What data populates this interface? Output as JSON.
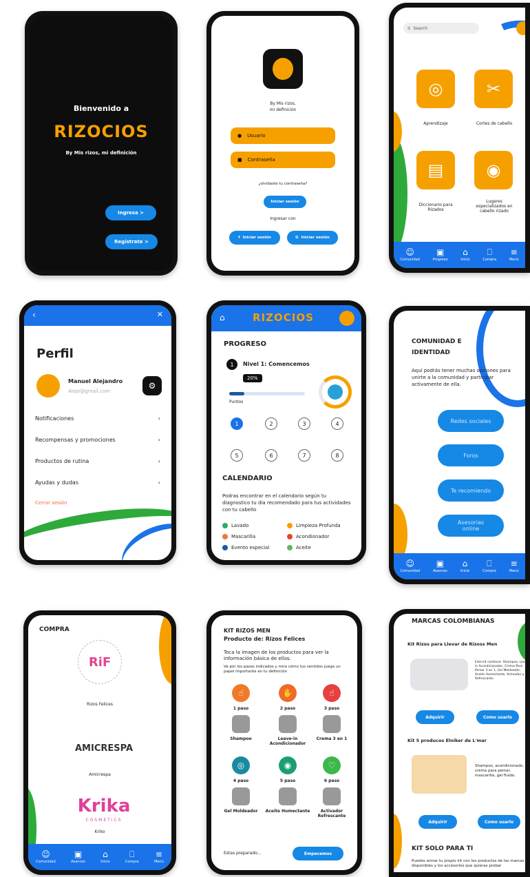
{
  "colors": {
    "blue": "#1a73e8",
    "button_blue": "#1688e5",
    "orange": "#f6a000",
    "green": "#2eaa3a",
    "black": "#0d0d0d"
  },
  "s1": {
    "welcome": "Bienvenido a",
    "brand": "RIZOCIOS",
    "tagline": "By Mis rizos, mi definición",
    "login": "Ingresa  >",
    "register": "Regístrate  >"
  },
  "s2": {
    "caption_1": "By Mis rizos,",
    "caption_2": "mi definición",
    "user": "Usuario",
    "password": "Contraseña",
    "forgot": "¿olvidaste tu contraseña?",
    "login": "Iniciar sesión",
    "login_with": "Ingresar con",
    "fb": "Iniciar sesión",
    "google": "Iniciar sesión"
  },
  "s3": {
    "search_placeholder": "Search",
    "tiles": [
      "Aprendizaje",
      "Cortes de cabello",
      "Diccionario para Rizados",
      "Lugares especializados en cabello rizado"
    ]
  },
  "nav": {
    "comunidad": "Comunidad",
    "progreso": "Progreso",
    "avances": "Avances",
    "inicio": "Inicio",
    "compra": "Compra",
    "menu": "Menú"
  },
  "s4": {
    "title": "Perfil",
    "name": "Manuel Alejandro",
    "email": "Alejo@gmail.com",
    "items": [
      "Notificaciones",
      "Recompensas y promociones",
      "Productos de rutina",
      "Ayudas y dudas"
    ],
    "logout": "Cerrar sesión"
  },
  "s5": {
    "brand": "RIZOCIOS",
    "progress_title": "PROGRESO",
    "level_num": "1",
    "level": "Nivel 1: Comencemos",
    "percent": "20%",
    "progress": 0.2,
    "points": "Puntos",
    "steps": [
      "1",
      "2",
      "3",
      "4",
      "5",
      "6",
      "7",
      "8"
    ],
    "calendar_title": "CALENDARIO",
    "calendar_text": "Podras encontrar en el calendario según tu diagnostico tu dia recomendado para tus actividades con tu cabello",
    "legend": [
      {
        "label": "Lavado",
        "color": "#2eaa6a"
      },
      {
        "label": "Limpieza Profunda",
        "color": "#f6a000"
      },
      {
        "label": "Mascarilla",
        "color": "#e87a3a"
      },
      {
        "label": "Acondionador",
        "color": "#e0482a"
      },
      {
        "label": "Evento especial",
        "color": "#1a5aa0"
      },
      {
        "label": "Aceite",
        "color": "#5cb85c"
      }
    ]
  },
  "s6": {
    "title_1": "COMUNIDAD E",
    "title_2": "IDENTIDAD",
    "text": "Aquí podrás tener muchas opciones para unirte a la comunidad y participar activamente de ella.",
    "buttons": [
      "Redes sociales",
      "Foros",
      "Te recomiendo",
      "Asesorias online"
    ]
  },
  "s7": {
    "title": "COMPRA",
    "brands": [
      "Rizos Felices",
      "Amicrespa",
      "Kriko"
    ],
    "logo1": "RiF",
    "logo2": "AMICRESPA",
    "logo3": "Krika",
    "logo3_sub": "COSMETICS"
  },
  "s8": {
    "title": "KIT RIZOS MEN",
    "subtitle": "Producto de: Rizos Felices",
    "text1": "Toca la imagen de los productos para ver la información básica de ellos.",
    "text2": "Ve por los pasos indicados y mira cómo tus sentidos juega un papel importante en tu definición",
    "steps": [
      "1 paso",
      "2 paso",
      "3 paso",
      "4 paso",
      "5 paso",
      "6 paso"
    ],
    "products": [
      "Shampoo",
      "Leave-in Acondicionador",
      "Crema 3 en 1",
      "Gel Moldeador",
      "Aceite Humectante",
      "Activador Refrescante"
    ],
    "ready": "Estas preparado...",
    "start": "Empecemos"
  },
  "s9": {
    "title": "MARCAS COLOMBIANAS",
    "kit1_title": "Kit Rizos para Llevar de Rizoss Men",
    "kit1_desc": "Este kit contiene: Shampoo, Leave-in Acondicionador, Crema Para Peinar 3 en 1, Gel Moldeador, Aceite Humectante, Activador y Refrescante",
    "buy": "Adquirir",
    "howto": "Como usarlo",
    "kit2_title": "Kit 5 producos Elniker de L'mar",
    "kit2_desc": "Shampoo, acondicionado, crema para peinar, mascarilla, gel fluido.",
    "buy2": "Adquirir",
    "howto2": "Como usarlo",
    "kit3_title": "KIT SOLO PARA TI",
    "kit3_text": "Puedes armar tu propio kit con los productos de las marcas disponibles y los accesorios que quieras probar"
  }
}
